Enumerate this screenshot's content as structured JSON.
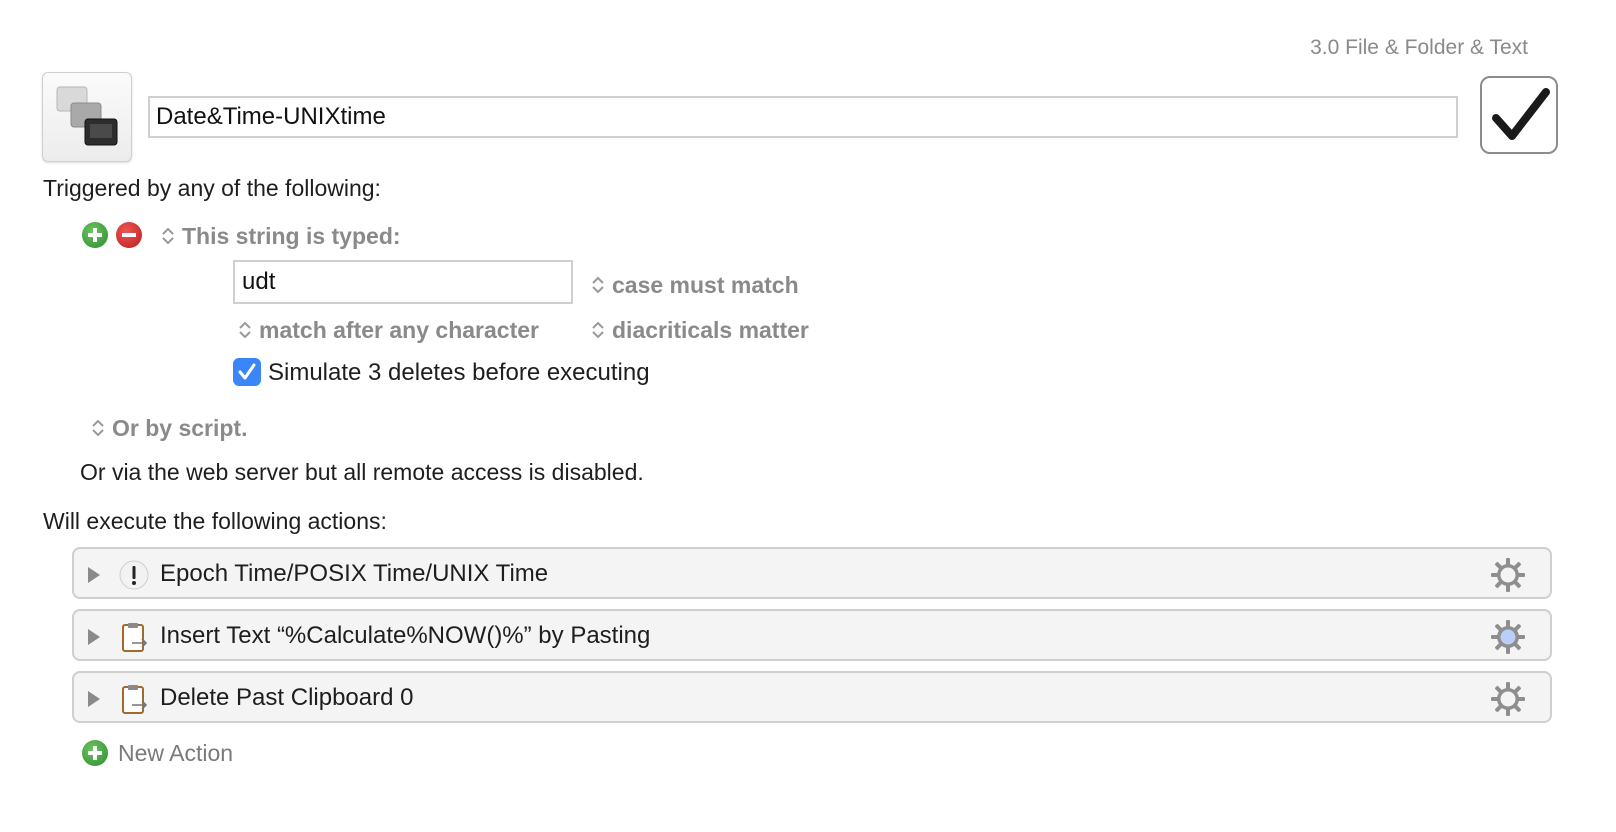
{
  "group_label": "3.0 File & Folder & Text",
  "macro": {
    "icon": "stacked-windows-icon",
    "name": "Date&Time-UNIXtime",
    "enabled": true
  },
  "triggers": {
    "heading": "Triggered by any of the following:",
    "string_trigger": {
      "type_label": "This string is typed:",
      "value": "udt",
      "case_option": "case must match",
      "match_option": "match after any character",
      "diacriticals_option": "diacriticals matter",
      "simulate_checked": true,
      "simulate_label": "Simulate 3 deletes before executing"
    },
    "script_option": "Or by script.",
    "web_server_note": "Or via the web server but all remote access is disabled."
  },
  "actions": {
    "heading": "Will execute the following actions:",
    "items": [
      {
        "title": "Epoch Time/POSIX Time/UNIX Time",
        "icon": "comment-exclamation-icon"
      },
      {
        "title": "Insert Text “%Calculate%NOW()%” by Pasting",
        "icon": "clipboard-icon"
      },
      {
        "title": "Delete Past Clipboard 0",
        "icon": "clipboard-icon"
      }
    ],
    "new_action_label": "New Action"
  },
  "colors": {
    "add": "#3a9a3a",
    "remove": "#cc2a2a",
    "checkbox": "#3b86f7",
    "muted": "#8a8a8a"
  }
}
